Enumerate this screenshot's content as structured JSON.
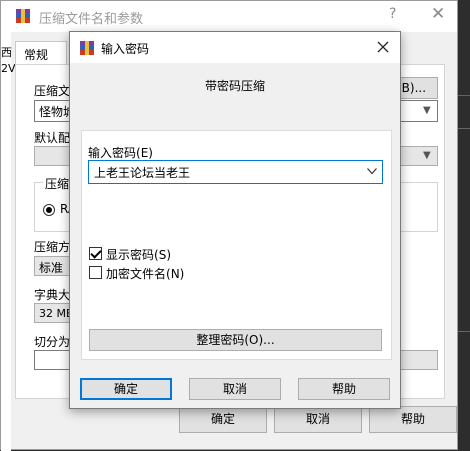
{
  "background_window": {
    "title": "压缩文件名和参数",
    "help_glyph": "?",
    "close_glyph": "✕",
    "tab_general": "常规",
    "edge_fragment_1": "西",
    "edge_fragment_2": "2V",
    "archive_name_label": "压缩文",
    "archive_name_value": "怪物城",
    "browse_button": "(B)...",
    "default_profile_label": "默认配",
    "format_group_label": "压缩",
    "format_radio_label": "RA",
    "method_label": "压缩方",
    "method_value": "标准",
    "dict_label": "字典大",
    "dict_value": "32 MB",
    "split_label": "切分为",
    "ok_button": "确定",
    "cancel_button": "取消",
    "help_button": "帮助"
  },
  "dialog": {
    "title": "输入密码",
    "header": "带密码压缩",
    "password_label_text": "输入密码",
    "password_label_key": "(E)",
    "password_value": "上老王论坛当老王",
    "show_password_text": "显示密码",
    "show_password_key": "(S)",
    "show_password_checked": true,
    "encrypt_names_text": "加密文件名",
    "encrypt_names_key": "(N)",
    "encrypt_names_checked": false,
    "organize_button_text": "整理密码",
    "organize_button_key": "(O)...",
    "ok_button": "确定",
    "cancel_button": "取消",
    "help_button": "帮助"
  },
  "colors": {
    "accent": "#0078d7",
    "window_bg": "#f0f0f0"
  }
}
